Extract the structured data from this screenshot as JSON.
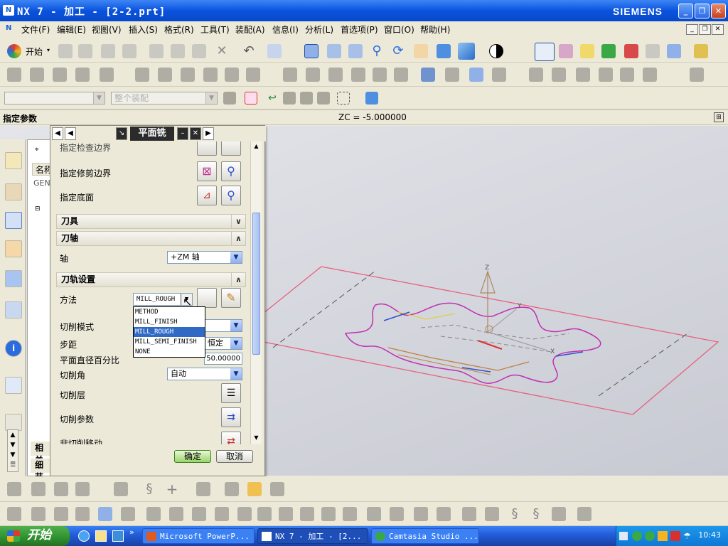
{
  "window": {
    "title": "NX 7 - 加工 - [2-2.prt]",
    "brand": "SIEMENS",
    "minimize": "_",
    "restore": "❐",
    "close": "✕",
    "app_icon": "nx-icon"
  },
  "menu": [
    "文件(F)",
    "编辑(E)",
    "视图(V)",
    "插入(S)",
    "格式(R)",
    "工具(T)",
    "装配(A)",
    "信息(I)",
    "分析(L)",
    "首选项(P)",
    "窗口(O)",
    "帮助(H)"
  ],
  "toolbar": {
    "start_label": "开始",
    "filter_combo": "",
    "assembly_combo": "整个装配"
  },
  "cue": {
    "prompt": "指定参数",
    "coord": "ZC = -5.000000"
  },
  "nav": {
    "col_name": "名称",
    "root": "GEN"
  },
  "dialog": {
    "title": "平面铣",
    "rows": {
      "check_boundary": "指定检查边界",
      "trim_boundary": "指定修剪边界",
      "floor": "指定底面"
    },
    "sections": {
      "tool": "刀具",
      "axis": "刀轴",
      "path": "刀轨设置"
    },
    "axis_label": "轴",
    "axis_value": "+ZM 轴",
    "method_label": "方法",
    "method_value": "MILL_ROUGH",
    "method_options": [
      "METHOD",
      "MILL_FINISH",
      "MILL_ROUGH",
      "MILL_SEMI_FINISH",
      "NONE"
    ],
    "cut_pattern": "切削模式",
    "stepover": "步距",
    "stepover_value": "恒定",
    "percent": "平面直径百分比",
    "percent_value": "50.00000",
    "cut_angle": "切削角",
    "cut_angle_value": "自动",
    "cut_levels": "切削层",
    "cut_params": "切削参数",
    "noncut": "非切削移动",
    "ok": "确定",
    "cancel": "取消"
  },
  "panel_tabs": {
    "related": "相关",
    "details": "细节"
  },
  "viewport": {
    "axis_z": "Z",
    "axis_x": "X",
    "axis_y": "Y"
  },
  "taskbar": {
    "start": "开始",
    "tasks": [
      "Microsoft PowerP...",
      "NX 7 - 加工 - [2...",
      "Camtasia Studio ..."
    ],
    "clock": "10:43"
  },
  "colors": {
    "accent": "#316AC5",
    "boundary": "#E8607A",
    "part": "#C030B0",
    "title_blue": "#0A53DE"
  }
}
